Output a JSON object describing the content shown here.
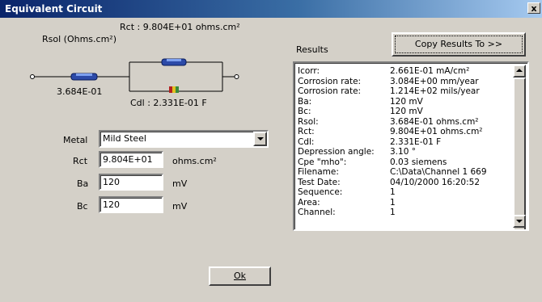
{
  "window": {
    "title": "Equivalent Circuit",
    "close_label": "x"
  },
  "circuit": {
    "rct_label": "Rct : 9.804E+01 ohms.cm²",
    "rsol_label": "Rsol (Ohms.cm²)",
    "rsol_value": "3.684E-01",
    "cdl_label": "Cdl : 2.331E-01 F"
  },
  "form": {
    "metal_label": "Metal",
    "metal_value": "Mild Steel",
    "rct_label": "Rct",
    "rct_value": "9.804E+01",
    "rct_unit": "ohms.cm²",
    "ba_label": "Ba",
    "ba_value": "120",
    "ba_unit": "mV",
    "bc_label": "Bc",
    "bc_value": "120",
    "bc_unit": "mV"
  },
  "results": {
    "label": "Results",
    "copy_button": "Copy Results To >>",
    "rows": [
      {
        "key": "Icorr:",
        "value": "2.661E-01 mA/cm²"
      },
      {
        "key": "Corrosion rate:",
        "value": "3.084E+00 mm/year"
      },
      {
        "key": "Corrosion rate:",
        "value": "1.214E+02 mils/year"
      },
      {
        "key": "Ba:",
        "value": "120 mV"
      },
      {
        "key": "Bc:",
        "value": "120 mV"
      },
      {
        "key": "Rsol:",
        "value": "3.684E-01 ohms.cm²"
      },
      {
        "key": "Rct:",
        "value": "9.804E+01 ohms.cm²"
      },
      {
        "key": "Cdl:",
        "value": "2.331E-01 F"
      },
      {
        "key": "Depression angle:",
        "value": "3.10 °"
      },
      {
        "key": "Cpe \"mho\":",
        "value": "0.03 siemens"
      },
      {
        "key": "Filename:",
        "value": "C:\\Data\\Channel 1 669"
      },
      {
        "key": "Test Date:",
        "value": "04/10/2000 16:20:52"
      },
      {
        "key": "Sequence:",
        "value": "1"
      },
      {
        "key": "Area:",
        "value": "1"
      },
      {
        "key": "Channel:",
        "value": "1"
      }
    ]
  },
  "ok_button": "Ok"
}
